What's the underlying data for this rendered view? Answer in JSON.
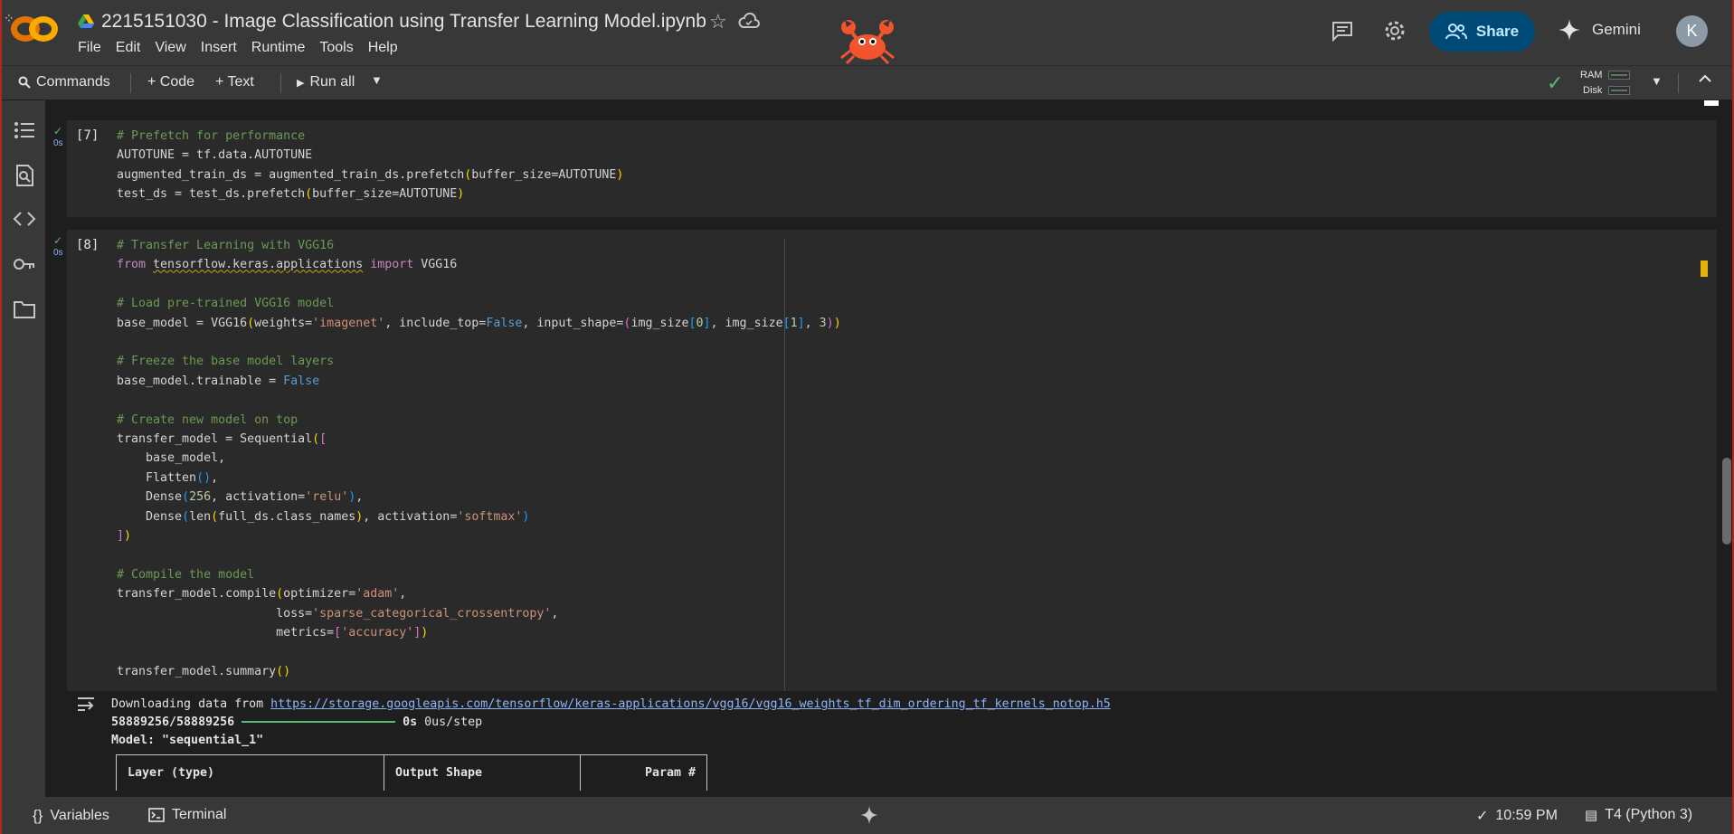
{
  "app": {
    "title": "2215151030 - Image Classification using Transfer Learning Model.ipynb",
    "menu": [
      "File",
      "Edit",
      "View",
      "Insert",
      "Runtime",
      "Tools",
      "Help"
    ],
    "share_label": "Share",
    "gemini_label": "Gemini",
    "avatar_initial": "K"
  },
  "toolbar": {
    "commands_label": "Commands",
    "code_label": "+ Code",
    "text_label": "+ Text",
    "run_all_label": "Run all",
    "ram_label": "RAM",
    "disk_label": "Disk"
  },
  "cells": [
    {
      "exec_count": "[7]",
      "status": "0s",
      "code_lines": [
        "# Prefetch for performance",
        "AUTOTUNE = tf.data.AUTOTUNE",
        "augmented_train_ds = augmented_train_ds.prefetch(buffer_size=AUTOTUNE)",
        "test_ds = test_ds.prefetch(buffer_size=AUTOTUNE)"
      ]
    },
    {
      "exec_count": "[8]",
      "status": "0s",
      "code_lines": [
        "# Transfer Learning with VGG16",
        "from tensorflow.keras.applications import VGG16",
        "",
        "# Load pre-trained VGG16 model",
        "base_model = VGG16(weights='imagenet', include_top=False, input_shape=(img_size[0], img_size[1], 3))",
        "",
        "# Freeze the base model layers",
        "base_model.trainable = False",
        "",
        "# Create new model on top",
        "transfer_model = Sequential([",
        "    base_model,",
        "    Flatten(),",
        "    Dense(256, activation='relu'),",
        "    Dense(len(full_ds.class_names), activation='softmax')",
        "])",
        "",
        "# Compile the model",
        "transfer_model.compile(optimizer='adam',",
        "                      loss='sparse_categorical_crossentropy',",
        "                      metrics=['accuracy'])",
        "",
        "transfer_model.summary()"
      ]
    }
  ],
  "output": {
    "download_prefix": "Downloading data from ",
    "download_url": "https://storage.googleapis.com/tensorflow/keras-applications/vgg16/vgg16_weights_tf_dim_ordering_tf_kernels_notop.h5",
    "progress_count": "58889256/58889256",
    "progress_fraction": 1.0,
    "progress_time": "0s",
    "progress_rate": "0us/step",
    "model_line": "Model: \"sequential_1\"",
    "table_headers": [
      "Layer (type)",
      "Output Shape",
      "Param #"
    ]
  },
  "statusbar": {
    "variables_label": "Variables",
    "terminal_label": "Terminal",
    "time": "10:59 PM",
    "runtime": "T4 (Python 3)"
  },
  "colors": {
    "share_bg": "#004a77",
    "accent_green": "#5bb974",
    "comment": "#6a9955",
    "string": "#ce9178",
    "keyword": "#c586c0",
    "boolean": "#569cd6"
  },
  "icons": [
    "colab-logo-icon",
    "drive-icon",
    "star-icon",
    "cloud-icon",
    "crab-icon",
    "comment-icon",
    "gear-icon",
    "share-people-icon",
    "gemini-sparkle-icon",
    "search-icon",
    "play-icon",
    "dropdown-icon",
    "check-icon",
    "collapse-icon",
    "toc-icon",
    "find-icon",
    "code-icon",
    "key-icon",
    "folder-icon",
    "output-icon",
    "variables-icon",
    "terminal-icon"
  ]
}
